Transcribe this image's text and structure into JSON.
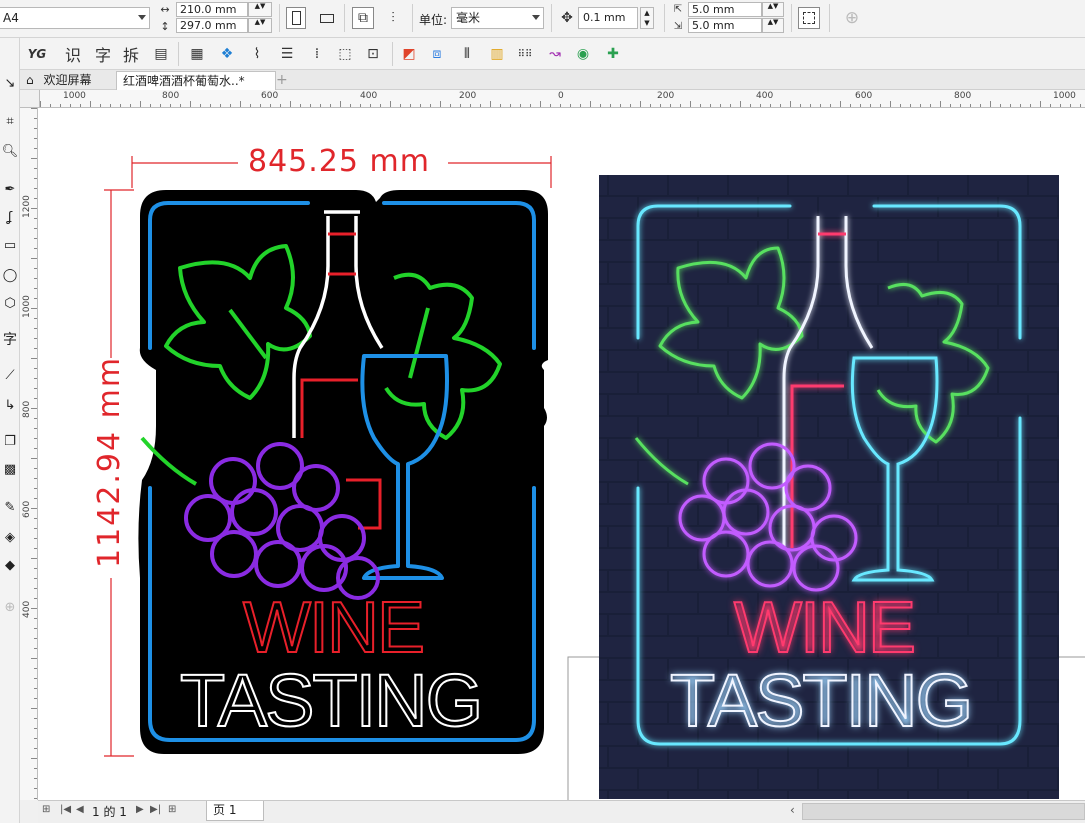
{
  "property_bar": {
    "paper_size": "A4",
    "width_value": "210.0 mm",
    "height_value": "297.0 mm",
    "units_label": "单位:",
    "units_value": "毫米",
    "nudge_value": "0.1 mm",
    "dup_x_value": "5.0 mm",
    "dup_y_value": "5.0 mm"
  },
  "toolbar2": {
    "ocr_label": "识",
    "char_label": "字",
    "split_label": "拆"
  },
  "tabs": {
    "welcome": "欢迎屏幕",
    "document": "红酒啤酒酒杯葡萄水..*"
  },
  "left_tools": {
    "text_tool_label": "字"
  },
  "hruler_labels": [
    "1000",
    "800",
    "600",
    "400",
    "200",
    "0",
    "200",
    "400",
    "600",
    "800",
    "1000"
  ],
  "vruler_labels": [
    "1200",
    "1000",
    "800",
    "600",
    "400"
  ],
  "artwork": {
    "width_dim": "845.25 mm",
    "height_dim": "1142.94 mm",
    "line1": "WINE",
    "line2": "TASTING"
  },
  "status": {
    "page_counter": "1 的 1",
    "page_tab": "页 1"
  },
  "colors": {
    "dimension_red": "#e0262b",
    "neon_blue": "#1e90e6",
    "neon_green": "#22d32a",
    "neon_purple": "#8a2be2",
    "neon_red": "#e8202a",
    "neon_pink": "#ff3a6e",
    "neon_cyan": "#67e8ff",
    "brick_dark": "#1b2036"
  }
}
